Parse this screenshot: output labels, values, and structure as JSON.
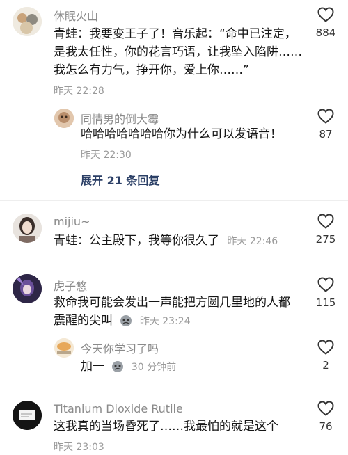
{
  "comments": [
    {
      "username": "休眠火山",
      "lines": [
        "青蛙：我要变王子了！音乐起：“命中已注定，",
        "是我太任性，你的花言巧语，让我坠入陷阱……",
        "我怎么有力气，挣开你，爱上你……”"
      ],
      "time": "昨天 22:28",
      "likes": "884"
    },
    {
      "username": "同情男的倒大霉",
      "text": "哈哈哈哈哈哈哈你为什么可以发语音！",
      "time": "昨天 22:30",
      "likes": "87"
    },
    {
      "username": "mijiu~",
      "text": "青蛙：公主殿下，我等你很久了",
      "time": "昨天 22:46",
      "likes": "275"
    },
    {
      "username": "虎子悠",
      "line1": "救命我可能会发出一声能把方圆几里地的人都",
      "line2": "震醒的尖叫",
      "time": "昨天 23:24",
      "likes": "115"
    },
    {
      "username": "今天你学习了吗",
      "text": "加一",
      "time": "30 分钟前",
      "likes": "2"
    },
    {
      "username": "Titanium Dioxide Rutile",
      "text": "这我真的当场昏死了……我最怕的就是这个",
      "time": "昨天 23:03",
      "likes": "76"
    }
  ],
  "expand_replies": "展开 21 条回复",
  "icons": {
    "like": "heart-outline-icon",
    "sticker": "sticker-icon"
  },
  "colors": {
    "username": "#8a8a8a",
    "link": "#2b3f66",
    "text": "#161616"
  }
}
